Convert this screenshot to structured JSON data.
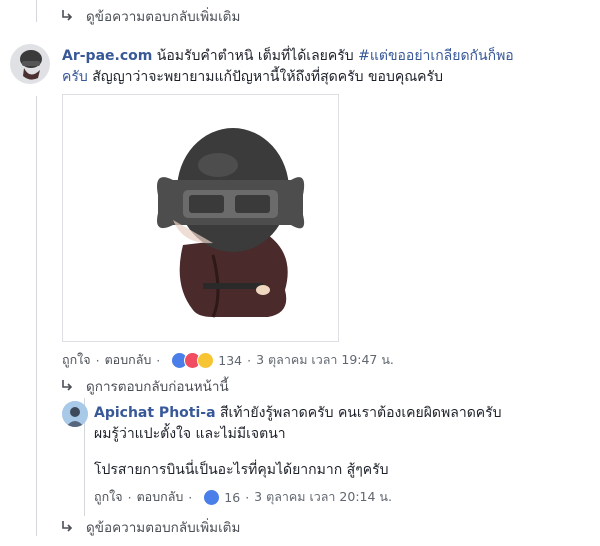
{
  "top_link": {
    "label": "ดูข้อความตอบกลับเพิ่มเติม"
  },
  "comment": {
    "author": "Ar-pae.com",
    "line1": "น้อมรับคำตำหนิ เต็มที่ได้เลยครับ",
    "hashtag": "#แต่ขออย่าเกลียดกันก็พอ",
    "line2_tag": "ครับ",
    "line2": " สัญญาว่าจะพยายามแก้ปัญหานี้ให้ถึงที่สุดครับ ขอบคุณครับ",
    "sticker_name": "sticker-image",
    "like": "ถูกใจ",
    "reply": "ตอบกลับ",
    "reaction_count": "134",
    "timestamp": "3 ตุลาคม เวลา 19:47 น.",
    "reaction_colors": {
      "like": "#4a7ee8",
      "love": "#f04c62",
      "haha": "#f7c433"
    }
  },
  "previous_link": {
    "label": "ดูการตอบกลับก่อนหน้านี้"
  },
  "reply": {
    "author": "Apichat Photi-a",
    "line1": " สีเท้ายังรู้พลาดครับ คนเราต้องเคยผิดพลาดครับ",
    "line2": "ผมรู้ว่าแปะตั้งใจ และไม่มีเจตนา",
    "line3": "โปรสายการบินนี่เป็นอะไรที่คุมได้ยากมาก สู้ๆครับ",
    "like": "ถูกใจ",
    "reply": "ตอบกลับ",
    "reaction_count": "16",
    "timestamp": "3 ตุลาคม เวลา 20:14 น."
  },
  "bottom_link": {
    "label": "ดูข้อความตอบกลับเพิ่มเติม"
  }
}
